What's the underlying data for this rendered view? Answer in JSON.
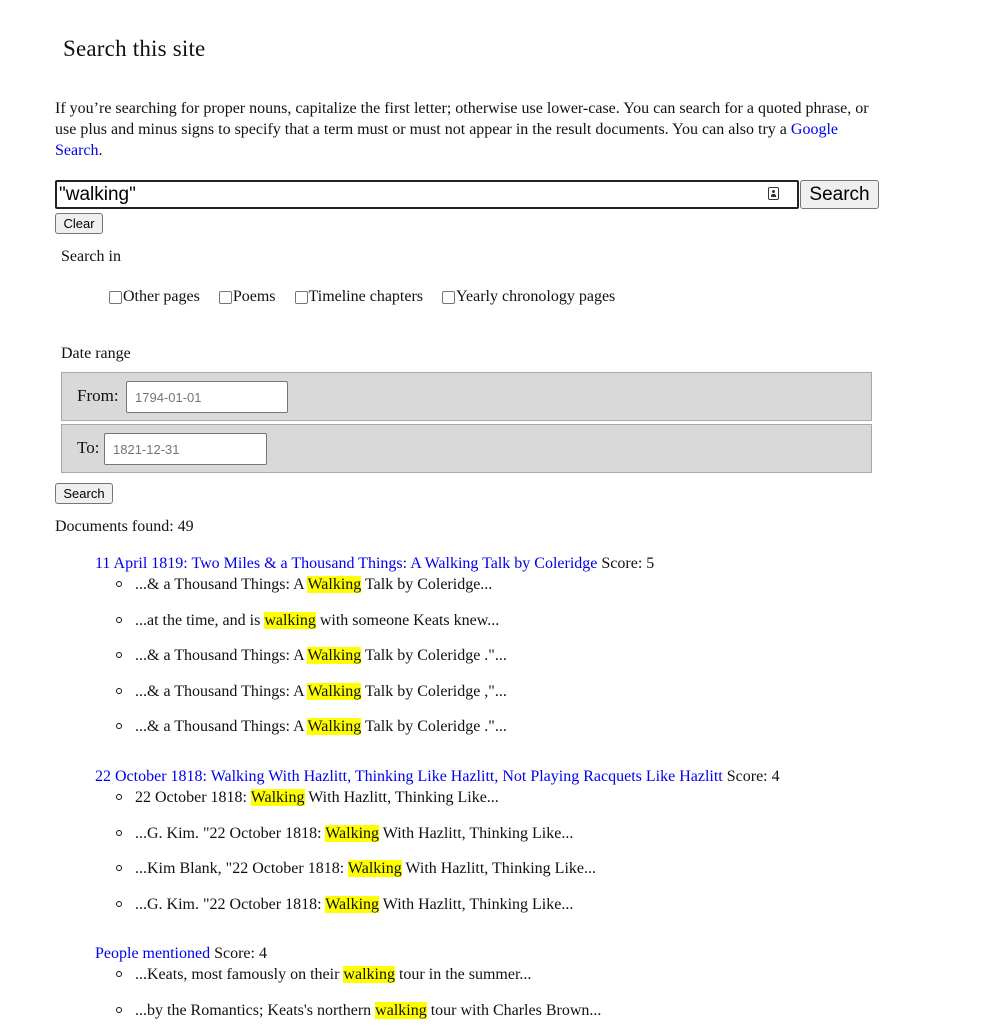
{
  "page": {
    "title": "Search this site",
    "intro_text": "If you’re searching for proper nouns, capitalize the first letter; otherwise use lower-case. You can search for a quoted phrase, or use plus and minus signs to specify that a term must or must not appear in the result documents. You can also try a ",
    "google_link": "Google Search",
    "intro_end": "."
  },
  "search": {
    "query": "\"walking\"",
    "submit_label": "Search",
    "clear_label": "Clear",
    "search_in_label": "Search in",
    "checkboxes": [
      {
        "label": "Other pages",
        "checked": false
      },
      {
        "label": "Poems",
        "checked": false
      },
      {
        "label": "Timeline chapters",
        "checked": false
      },
      {
        "label": "Yearly chronology pages",
        "checked": false
      }
    ],
    "date_range_label": "Date range",
    "from_label": "From:",
    "from_placeholder": "1794-01-01",
    "to_label": "To:",
    "to_placeholder": "1821-12-31",
    "submit2_label": "Search"
  },
  "results": {
    "count_text": "Documents found: 49",
    "highlight_color": "#ffff00",
    "link_color": "#0000ee",
    "items": [
      {
        "title": "11 April 1819: Two Miles & a Thousand Things: A Walking Talk by Coleridge",
        "score": "Score: 5",
        "snippets": [
          {
            "pre": "...& a Thousand Things: A ",
            "hit": "Walking",
            "post": " Talk by Coleridge..."
          },
          {
            "pre": "...at the time, and is ",
            "hit": "walking",
            "post": " with someone Keats knew..."
          },
          {
            "pre": "...& a Thousand Things: A ",
            "hit": "Walking",
            "post": " Talk by Coleridge .\"..."
          },
          {
            "pre": "...& a Thousand Things: A ",
            "hit": "Walking",
            "post": " Talk by Coleridge ,\"..."
          },
          {
            "pre": "...& a Thousand Things: A ",
            "hit": "Walking",
            "post": " Talk by Coleridge .\"..."
          }
        ]
      },
      {
        "title": "22 October 1818: Walking With Hazlitt, Thinking Like Hazlitt, Not Playing Racquets Like Hazlitt",
        "score": "Score: 4",
        "snippets": [
          {
            "pre": "22 October 1818: ",
            "hit": "Walking",
            "post": " With Hazlitt, Thinking Like..."
          },
          {
            "pre": "...G. Kim. \"22 October 1818: ",
            "hit": "Walking",
            "post": " With Hazlitt, Thinking Like..."
          },
          {
            "pre": "...Kim Blank, \"22 October 1818: ",
            "hit": "Walking",
            "post": " With Hazlitt, Thinking Like..."
          },
          {
            "pre": "...G. Kim. \"22 October 1818: ",
            "hit": "Walking",
            "post": " With Hazlitt, Thinking Like..."
          }
        ]
      },
      {
        "title": "People mentioned",
        "score": "Score: 4",
        "snippets": [
          {
            "pre": "...Keats, most famously on their ",
            "hit": "walking",
            "post": " tour in the summer..."
          },
          {
            "pre": "...by the Romantics; Keats's northern ",
            "hit": "walking",
            "post": " tour with Charles Brown..."
          }
        ]
      }
    ]
  }
}
